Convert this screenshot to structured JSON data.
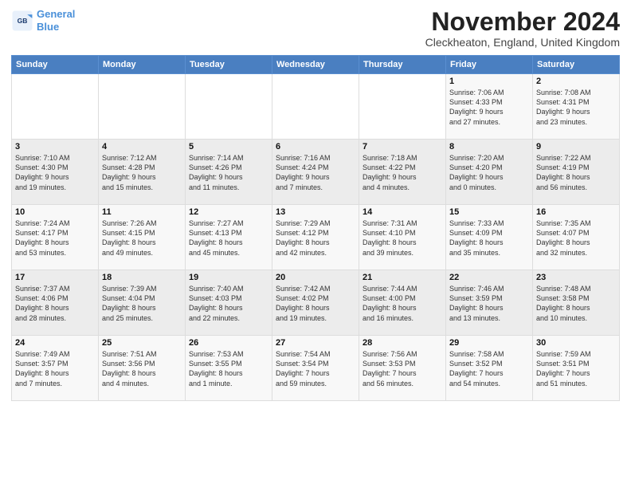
{
  "logo": {
    "line1": "General",
    "line2": "Blue"
  },
  "title": "November 2024",
  "location": "Cleckheaton, England, United Kingdom",
  "headers": [
    "Sunday",
    "Monday",
    "Tuesday",
    "Wednesday",
    "Thursday",
    "Friday",
    "Saturday"
  ],
  "weeks": [
    [
      {
        "day": "",
        "info": ""
      },
      {
        "day": "",
        "info": ""
      },
      {
        "day": "",
        "info": ""
      },
      {
        "day": "",
        "info": ""
      },
      {
        "day": "",
        "info": ""
      },
      {
        "day": "1",
        "info": "Sunrise: 7:06 AM\nSunset: 4:33 PM\nDaylight: 9 hours\nand 27 minutes."
      },
      {
        "day": "2",
        "info": "Sunrise: 7:08 AM\nSunset: 4:31 PM\nDaylight: 9 hours\nand 23 minutes."
      }
    ],
    [
      {
        "day": "3",
        "info": "Sunrise: 7:10 AM\nSunset: 4:30 PM\nDaylight: 9 hours\nand 19 minutes."
      },
      {
        "day": "4",
        "info": "Sunrise: 7:12 AM\nSunset: 4:28 PM\nDaylight: 9 hours\nand 15 minutes."
      },
      {
        "day": "5",
        "info": "Sunrise: 7:14 AM\nSunset: 4:26 PM\nDaylight: 9 hours\nand 11 minutes."
      },
      {
        "day": "6",
        "info": "Sunrise: 7:16 AM\nSunset: 4:24 PM\nDaylight: 9 hours\nand 7 minutes."
      },
      {
        "day": "7",
        "info": "Sunrise: 7:18 AM\nSunset: 4:22 PM\nDaylight: 9 hours\nand 4 minutes."
      },
      {
        "day": "8",
        "info": "Sunrise: 7:20 AM\nSunset: 4:20 PM\nDaylight: 9 hours\nand 0 minutes."
      },
      {
        "day": "9",
        "info": "Sunrise: 7:22 AM\nSunset: 4:19 PM\nDaylight: 8 hours\nand 56 minutes."
      }
    ],
    [
      {
        "day": "10",
        "info": "Sunrise: 7:24 AM\nSunset: 4:17 PM\nDaylight: 8 hours\nand 53 minutes."
      },
      {
        "day": "11",
        "info": "Sunrise: 7:26 AM\nSunset: 4:15 PM\nDaylight: 8 hours\nand 49 minutes."
      },
      {
        "day": "12",
        "info": "Sunrise: 7:27 AM\nSunset: 4:13 PM\nDaylight: 8 hours\nand 45 minutes."
      },
      {
        "day": "13",
        "info": "Sunrise: 7:29 AM\nSunset: 4:12 PM\nDaylight: 8 hours\nand 42 minutes."
      },
      {
        "day": "14",
        "info": "Sunrise: 7:31 AM\nSunset: 4:10 PM\nDaylight: 8 hours\nand 39 minutes."
      },
      {
        "day": "15",
        "info": "Sunrise: 7:33 AM\nSunset: 4:09 PM\nDaylight: 8 hours\nand 35 minutes."
      },
      {
        "day": "16",
        "info": "Sunrise: 7:35 AM\nSunset: 4:07 PM\nDaylight: 8 hours\nand 32 minutes."
      }
    ],
    [
      {
        "day": "17",
        "info": "Sunrise: 7:37 AM\nSunset: 4:06 PM\nDaylight: 8 hours\nand 28 minutes."
      },
      {
        "day": "18",
        "info": "Sunrise: 7:39 AM\nSunset: 4:04 PM\nDaylight: 8 hours\nand 25 minutes."
      },
      {
        "day": "19",
        "info": "Sunrise: 7:40 AM\nSunset: 4:03 PM\nDaylight: 8 hours\nand 22 minutes."
      },
      {
        "day": "20",
        "info": "Sunrise: 7:42 AM\nSunset: 4:02 PM\nDaylight: 8 hours\nand 19 minutes."
      },
      {
        "day": "21",
        "info": "Sunrise: 7:44 AM\nSunset: 4:00 PM\nDaylight: 8 hours\nand 16 minutes."
      },
      {
        "day": "22",
        "info": "Sunrise: 7:46 AM\nSunset: 3:59 PM\nDaylight: 8 hours\nand 13 minutes."
      },
      {
        "day": "23",
        "info": "Sunrise: 7:48 AM\nSunset: 3:58 PM\nDaylight: 8 hours\nand 10 minutes."
      }
    ],
    [
      {
        "day": "24",
        "info": "Sunrise: 7:49 AM\nSunset: 3:57 PM\nDaylight: 8 hours\nand 7 minutes."
      },
      {
        "day": "25",
        "info": "Sunrise: 7:51 AM\nSunset: 3:56 PM\nDaylight: 8 hours\nand 4 minutes."
      },
      {
        "day": "26",
        "info": "Sunrise: 7:53 AM\nSunset: 3:55 PM\nDaylight: 8 hours\nand 1 minute."
      },
      {
        "day": "27",
        "info": "Sunrise: 7:54 AM\nSunset: 3:54 PM\nDaylight: 7 hours\nand 59 minutes."
      },
      {
        "day": "28",
        "info": "Sunrise: 7:56 AM\nSunset: 3:53 PM\nDaylight: 7 hours\nand 56 minutes."
      },
      {
        "day": "29",
        "info": "Sunrise: 7:58 AM\nSunset: 3:52 PM\nDaylight: 7 hours\nand 54 minutes."
      },
      {
        "day": "30",
        "info": "Sunrise: 7:59 AM\nSunset: 3:51 PM\nDaylight: 7 hours\nand 51 minutes."
      }
    ]
  ]
}
